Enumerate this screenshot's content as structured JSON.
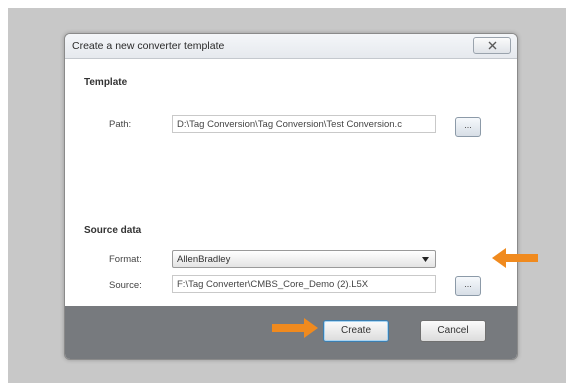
{
  "dialog": {
    "title": "Create a new converter template",
    "close_icon": "close-icon"
  },
  "template_section": {
    "heading": "Template",
    "path_label": "Path:",
    "path_value": "D:\\Tag Conversion\\Tag Conversion\\Test Conversion.c",
    "browse_label": "..."
  },
  "source_section": {
    "heading": "Source data",
    "format_label": "Format:",
    "format_value": "AllenBradley",
    "source_label": "Source:",
    "source_value": "F:\\Tag Converter\\CMBS_Core_Demo (2).L5X",
    "browse_label": "..."
  },
  "footer": {
    "create_label": "Create",
    "cancel_label": "Cancel"
  },
  "colors": {
    "annotation_arrow": "#f08a1e",
    "footer_bar": "#777a7e"
  }
}
